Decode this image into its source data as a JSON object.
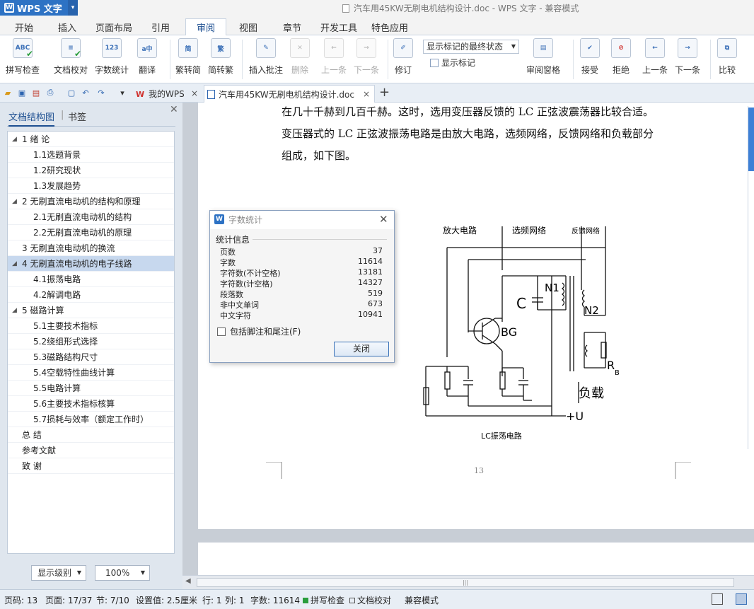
{
  "app": {
    "name": "WPS 文字",
    "window_title": "汽车用45KW无刷电机结构设计.doc - WPS 文字 - 兼容模式"
  },
  "menu_tabs": [
    "开始",
    "插入",
    "页面布局",
    "引用",
    "审阅",
    "视图",
    "章节",
    "开发工具",
    "特色应用"
  ],
  "ribbon": {
    "spell_check": "拼写检查",
    "doc_proofread": "文档校对",
    "word_count": "字数统计",
    "translate": "翻译",
    "trad_to_simp": "繁转简",
    "simp_to_trad": "简转繁",
    "insert_comment": "插入批注",
    "delete": "删除",
    "prev": "上一条",
    "next": "下一条",
    "revise": "修订",
    "markup_state": "显示标记的最终状态",
    "show_markup": "显示标记",
    "review_pane": "审阅窗格",
    "accept": "接受",
    "reject": "拒绝",
    "prev2": "上一条",
    "next2": "下一条",
    "compare": "比较"
  },
  "doc_tabs": {
    "my_wps": "我的WPS",
    "current_doc": "汽车用45KW无刷电机结构设计.doc"
  },
  "nav": {
    "tab_outline": "文档结构图",
    "tab_bookmark": "书签",
    "items": [
      {
        "label": "1  绪    论",
        "level": 1,
        "expandable": true
      },
      {
        "label": "1.1选题背景",
        "level": 2
      },
      {
        "label": "1.2研究现状",
        "level": 2
      },
      {
        "label": "1.3发展趋势",
        "level": 2
      },
      {
        "label": "2  无刷直流电动机的结构和原理",
        "level": 1,
        "expandable": true
      },
      {
        "label": "2.1无刷直流电动机的结构",
        "level": 2
      },
      {
        "label": "2.2无刷直流电动机的原理",
        "level": 2
      },
      {
        "label": "3  无刷直流电动机的换流",
        "level": 1
      },
      {
        "label": "4  无刷直流电动机的电子线路",
        "level": 1,
        "expandable": true,
        "selected": true
      },
      {
        "label": "4.1振荡电路",
        "level": 2
      },
      {
        "label": "4.2解调电路",
        "level": 2
      },
      {
        "label": "5  磁路计算",
        "level": 1,
        "expandable": true
      },
      {
        "label": "5.1主要技术指标",
        "level": 2
      },
      {
        "label": "5.2绕组形式选择",
        "level": 2
      },
      {
        "label": "5.3磁路结构尺寸",
        "level": 2
      },
      {
        "label": "5.4空载特性曲线计算",
        "level": 2
      },
      {
        "label": "5.5电路计算",
        "level": 2
      },
      {
        "label": "5.6主要技术指标核算",
        "level": 2
      },
      {
        "label": "5.7损耗与效率（额定工作时）",
        "level": 2
      },
      {
        "label": "总    结",
        "level": 1
      },
      {
        "label": "参考文献",
        "level": 1
      },
      {
        "label": "致    谢",
        "level": 1
      }
    ],
    "display_level": "显示级别",
    "zoom": "100%"
  },
  "document": {
    "lines": [
      "在几十千赫到几百千赫。这时，选用变压器反馈的 LC 正弦波震荡器比较合适。",
      "变压器式的 LC 正弦波振荡电路是由放大电路，选频网络，反馈网络和负载部分",
      "组成，如下图。"
    ],
    "page_number": "13",
    "figure": {
      "label_amp": "放大电路",
      "label_select": "选频网络",
      "label_feedback": "反馈网络",
      "label_c": "C",
      "label_n1": "N1",
      "label_n2": "N2",
      "label_bg": "BG",
      "label_rb": "R",
      "label_rb_sub": "B",
      "label_load": "负载",
      "label_supply": "+U",
      "caption": "LC振荡电路"
    }
  },
  "dialog": {
    "title": "字数统计",
    "section": "统计信息",
    "stats": [
      {
        "label": "页数",
        "value": "37"
      },
      {
        "label": "字数",
        "value": "11614"
      },
      {
        "label": "字符数(不计空格)",
        "value": "13181"
      },
      {
        "label": "字符数(计空格)",
        "value": "14327"
      },
      {
        "label": "段落数",
        "value": "519"
      },
      {
        "label": "非中文单词",
        "value": "673"
      },
      {
        "label": "中文字符",
        "value": "10941"
      }
    ],
    "checkbox_label": "包括脚注和尾注(F)",
    "close_button": "关闭"
  },
  "status": {
    "page_code": "页码: 13",
    "page": "页面: 17/37",
    "section": "节: 7/10",
    "setting": "设置值: 2.5厘米",
    "row": "行: 1",
    "col": "列: 1",
    "word_count": "字数: 11614",
    "spell_check": "拼写检查",
    "doc_proofread": "文档校对",
    "compat_mode": "兼容模式"
  },
  "colors": {
    "brand": "#2d72c4",
    "selected_nav": "#c7d8ee"
  }
}
